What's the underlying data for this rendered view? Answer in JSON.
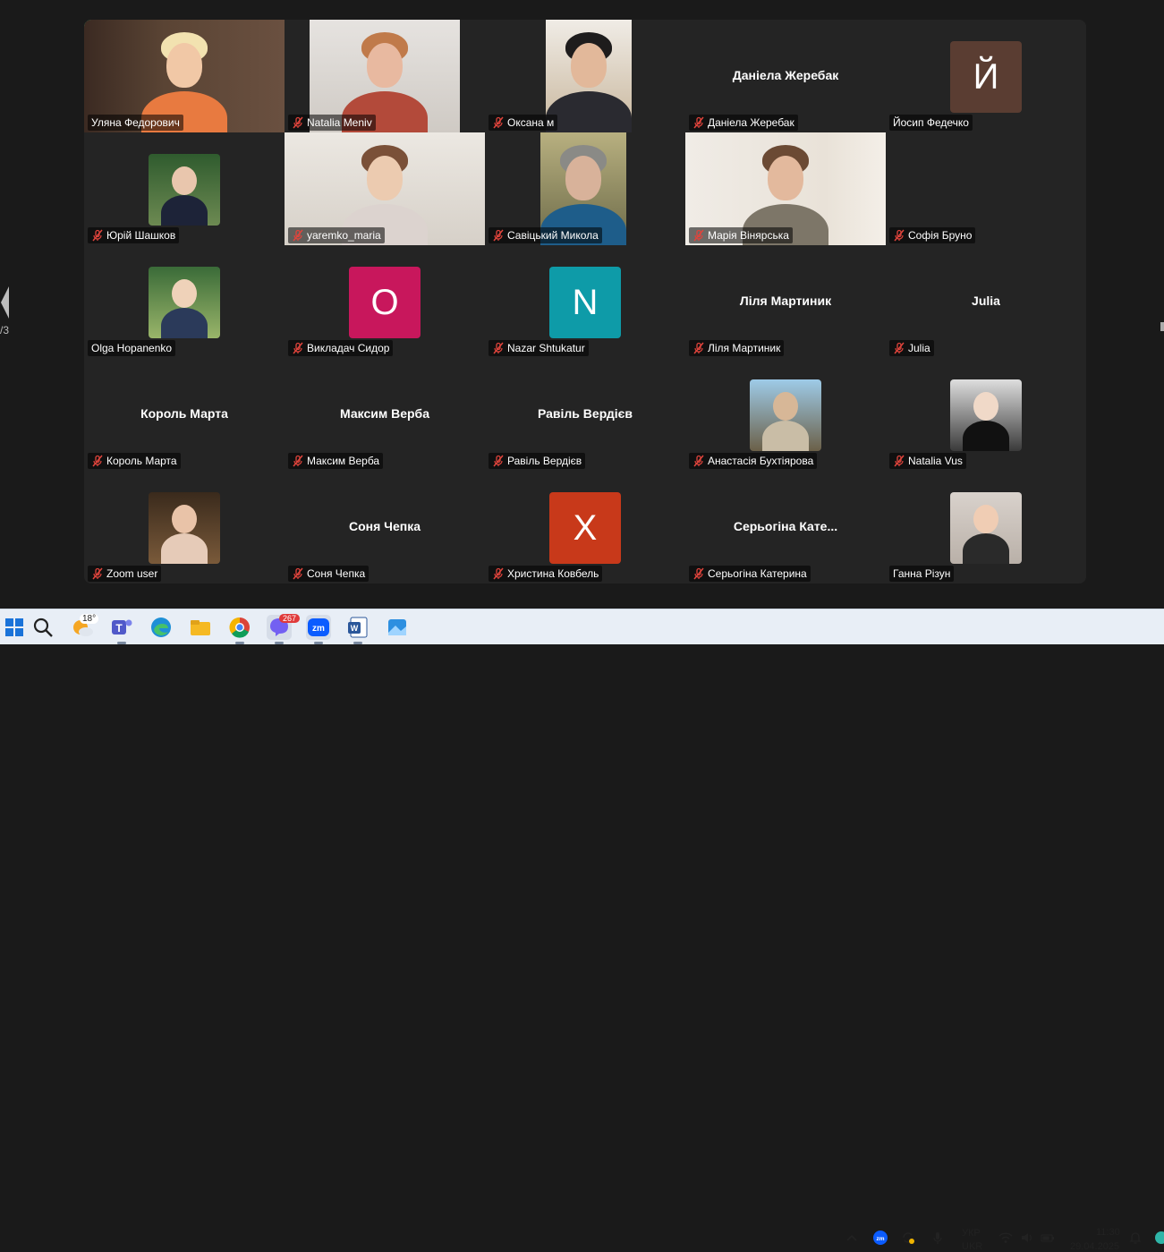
{
  "participants": [
    {
      "name": "Уляна Федорович",
      "type": "video",
      "muted": false,
      "active": true
    },
    {
      "name": "Natalia Meniv",
      "type": "video",
      "muted": true
    },
    {
      "name": "Оксана м",
      "type": "video",
      "muted": true
    },
    {
      "name": "Даніела Жеребак",
      "display": "Даніела Жеребак",
      "type": "name",
      "muted": true
    },
    {
      "name": "Йосип Федечко",
      "letter": "Й",
      "color": "#5a3d32",
      "type": "letter",
      "muted": false
    },
    {
      "name": "Юрій Шашков",
      "type": "photo",
      "muted": true
    },
    {
      "name": "yaremko_maria",
      "type": "video",
      "muted": true
    },
    {
      "name": "Савіцький Микола",
      "type": "video",
      "muted": true
    },
    {
      "name": "Марія Вінярська",
      "type": "video",
      "muted": true
    },
    {
      "name": "Софія Бруно",
      "type": "empty",
      "muted": true
    },
    {
      "name": "Olga Hopanenko",
      "type": "photo",
      "muted": false
    },
    {
      "name": "Викладач Сидор",
      "letter": "O",
      "color": "#c8175c",
      "type": "letter",
      "muted": true
    },
    {
      "name": "Nazar Shtukatur",
      "letter": "N",
      "color": "#0e9ba8",
      "type": "letter",
      "muted": true
    },
    {
      "name": "Ліля Мартиник",
      "display": "Ліля Мартиник",
      "type": "name",
      "muted": true
    },
    {
      "name": "Julia",
      "display": "Julia",
      "type": "name",
      "muted": true
    },
    {
      "name": "Король Марта",
      "display": "Король Марта",
      "type": "name",
      "muted": true
    },
    {
      "name": "Максим Верба",
      "display": "Максим Верба",
      "type": "name",
      "muted": true
    },
    {
      "name": "Равіль Вердієв",
      "display": "Равіль Вердієв",
      "type": "name",
      "muted": true
    },
    {
      "name": "Анастасія Бухтіярова",
      "type": "photo",
      "muted": true
    },
    {
      "name": "Natalia Vus",
      "type": "photo",
      "muted": true
    },
    {
      "name": "Zoom user",
      "type": "photo",
      "muted": true
    },
    {
      "name": "Соня Чепка",
      "display": "Соня Чепка",
      "type": "name",
      "muted": true
    },
    {
      "name": "Христина Ковбель",
      "letter": "Х",
      "color": "#c8391a",
      "type": "letter",
      "muted": true
    },
    {
      "name": "Серьогіна Катерина",
      "display": "Серьогіна Кате...",
      "type": "name",
      "muted": true
    },
    {
      "name": "Ганна Різун",
      "type": "photo",
      "muted": false
    }
  ],
  "page_indicator": "/3",
  "taskbar": {
    "weather_temp": "18°",
    "viber_badge": "267",
    "lang_top": "УКР",
    "lang_bottom": "UKR",
    "time": "11:30",
    "date": "29.04.2025",
    "icons": [
      "start-icon",
      "search-icon",
      "weather-icon",
      "teams-icon",
      "edge-icon",
      "file-explorer-icon",
      "chrome-icon",
      "viber-icon",
      "zoom-icon",
      "word-icon",
      "photos-icon"
    ]
  },
  "colors": {
    "active_speaker": "#26d07c",
    "tile_bg": "#242424",
    "muted_red": "#e0443c"
  }
}
